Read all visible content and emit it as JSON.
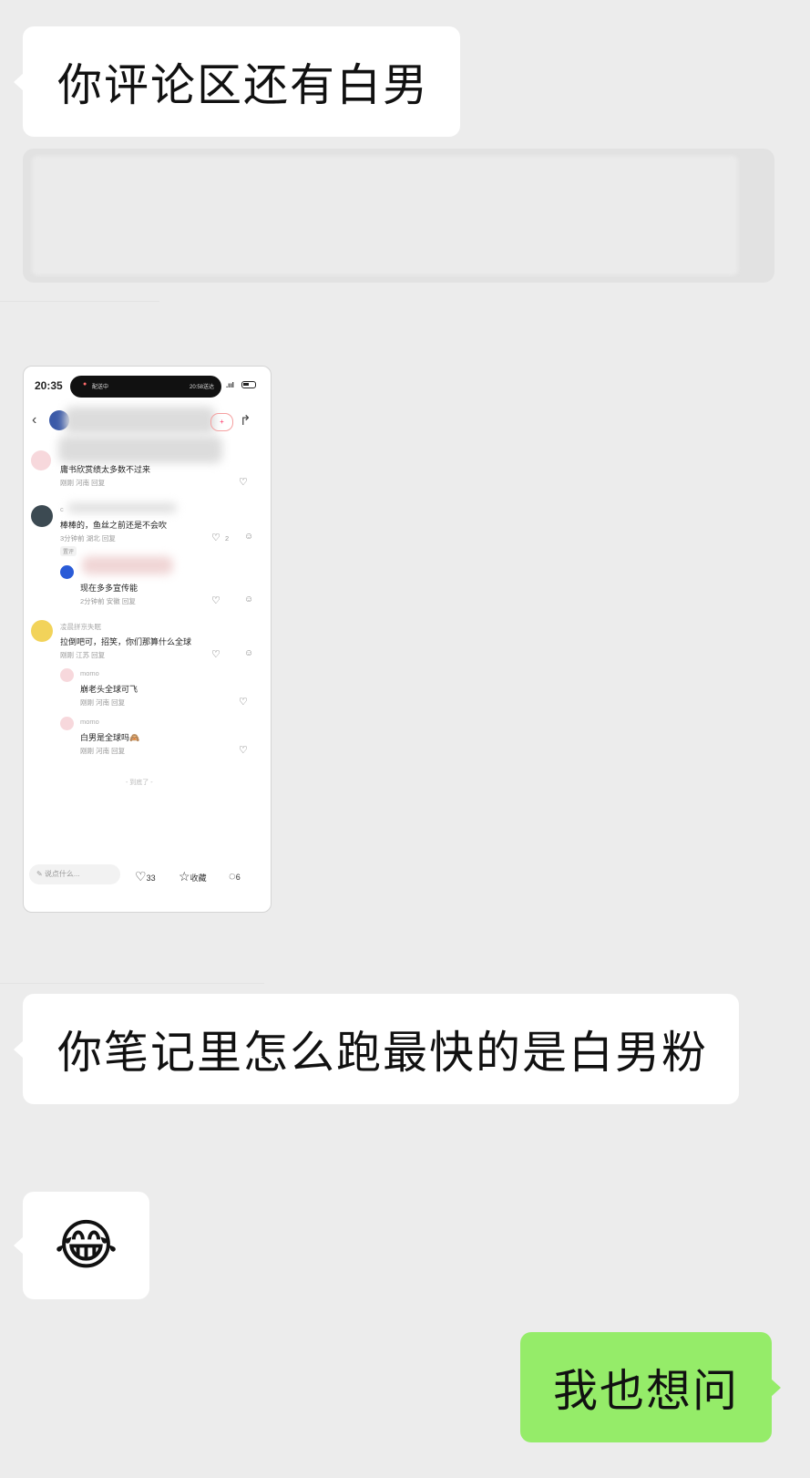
{
  "messages": {
    "m1": "你评论区还有白男",
    "m2": "你笔记里怎么跑最快的是白男粉",
    "m3_emoji": "😂",
    "m4": "我也想问"
  },
  "colors": {
    "background": "#ececec",
    "incoming_bubble": "#ffffff",
    "outgoing_bubble": "#95ec69"
  },
  "screenshot": {
    "status_time": "20:35",
    "status_left": "配送中",
    "status_right": "20:58送达",
    "comments": [
      {
        "text": "庸书欣赏绩太多数不过来",
        "meta": "刚刚 河南  回复"
      },
      {
        "name": "c",
        "text": "棒棒的，鱼丝之前还是不会吹",
        "meta": "3分钟前 湖北  回复",
        "likes": "2",
        "tag": "置评"
      },
      {
        "text": "现在多多宣传能",
        "meta": "2分钟前 安徽  回复"
      },
      {
        "name": "凌晨拼京失眠",
        "text": "拉倒吧可，招笑，你们那算什么全球",
        "meta": "刚刚 江苏  回复"
      },
      {
        "name": "momo",
        "text": "崩老头全球可飞",
        "meta": "刚刚 河南  回复"
      },
      {
        "name": "momo",
        "text": "白男是全球吗🙈",
        "meta": "刚刚 河南  回复"
      }
    ],
    "end_text": "- 到底了 -",
    "input_placeholder": "说点什么...",
    "like_count": "33",
    "collect_label": "收藏",
    "comment_count": "6"
  }
}
